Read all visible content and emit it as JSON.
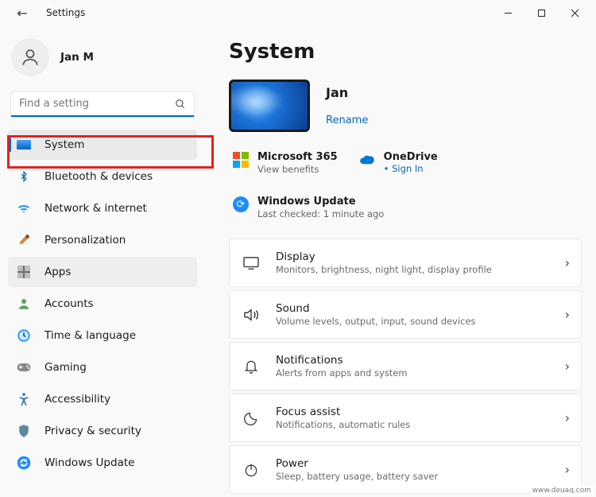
{
  "window": {
    "title": "Settings"
  },
  "user": {
    "name": "Jan M"
  },
  "search": {
    "placeholder": "Find a setting"
  },
  "sidebar": {
    "items": [
      {
        "label": "System"
      },
      {
        "label": "Bluetooth & devices"
      },
      {
        "label": "Network & internet"
      },
      {
        "label": "Personalization"
      },
      {
        "label": "Apps"
      },
      {
        "label": "Accounts"
      },
      {
        "label": "Time & language"
      },
      {
        "label": "Gaming"
      },
      {
        "label": "Accessibility"
      },
      {
        "label": "Privacy & security"
      },
      {
        "label": "Windows Update"
      }
    ]
  },
  "main": {
    "title": "System",
    "device": {
      "name": "Jan",
      "rename": "Rename"
    },
    "status": {
      "ms365": {
        "title": "Microsoft 365",
        "sub": "View benefits"
      },
      "onedrive": {
        "title": "OneDrive",
        "sub": "Sign In"
      },
      "wu": {
        "title": "Windows Update",
        "sub": "Last checked: 1 minute ago"
      }
    },
    "cards": [
      {
        "title": "Display",
        "sub": "Monitors, brightness, night light, display profile"
      },
      {
        "title": "Sound",
        "sub": "Volume levels, output, input, sound devices"
      },
      {
        "title": "Notifications",
        "sub": "Alerts from apps and system"
      },
      {
        "title": "Focus assist",
        "sub": "Notifications, automatic rules"
      },
      {
        "title": "Power",
        "sub": "Sleep, battery usage, battery saver"
      }
    ]
  },
  "watermark": "www.deuaq.com"
}
